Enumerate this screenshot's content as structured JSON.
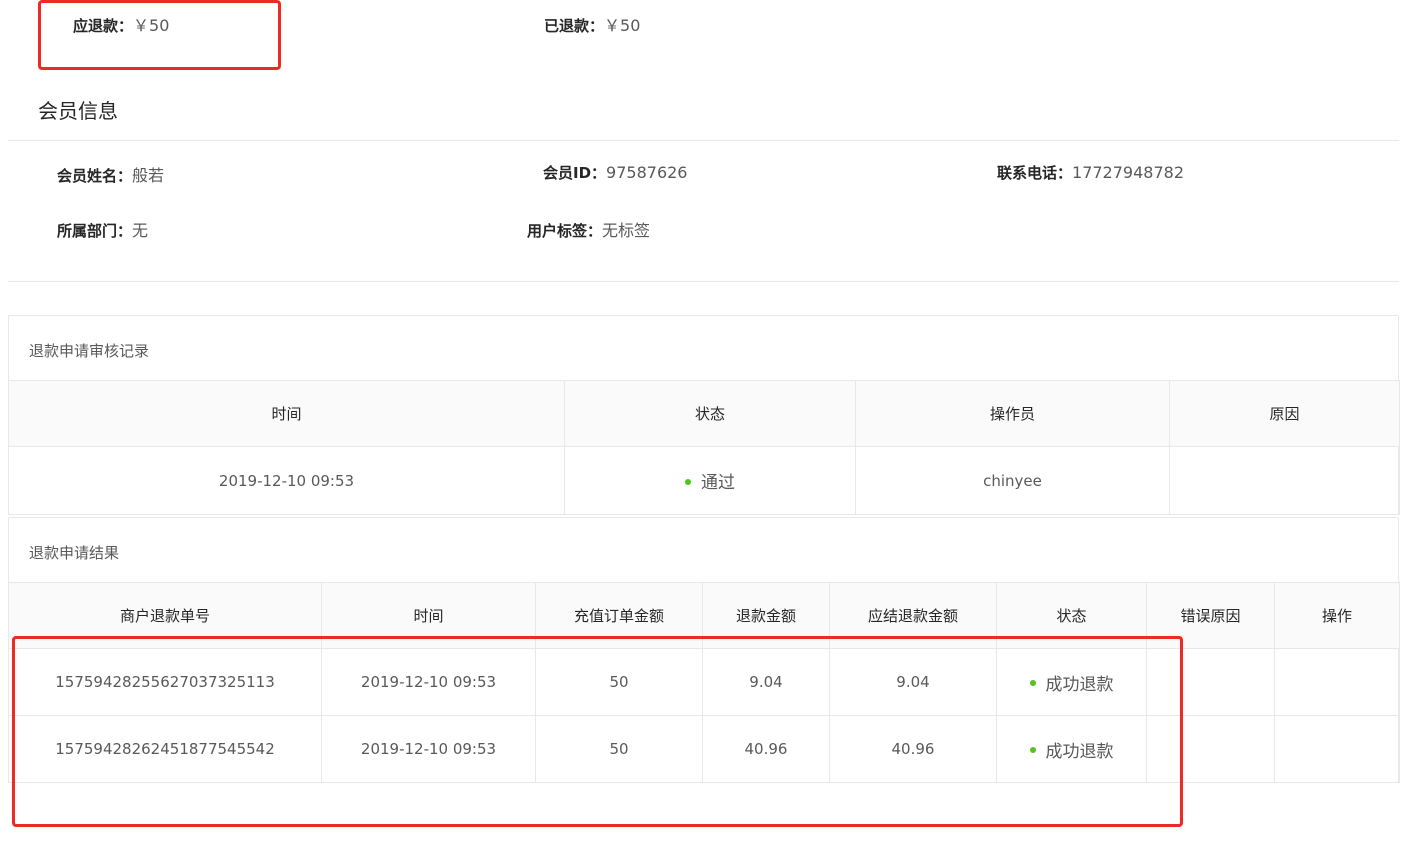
{
  "refund": {
    "due_label": "应退款：",
    "due_value": "￥50",
    "refunded_label": "已退款：",
    "refunded_value": "￥50"
  },
  "member": {
    "section_title": "会员信息",
    "name_label": "会员姓名：",
    "name_value": "般若",
    "id_label": "会员ID：",
    "id_value": "97587626",
    "phone_label": "联系电话：",
    "phone_value": "17727948782",
    "dept_label": "所属部门：",
    "dept_value": "无",
    "tag_label": "用户标签：",
    "tag_value": "无标签"
  },
  "review": {
    "title": "退款申请审核记录",
    "headers": [
      "时间",
      "状态",
      "操作员",
      "原因"
    ],
    "rows": [
      {
        "time": "2019-12-10 09:53",
        "status": "通过",
        "operator": "chinyee",
        "reason": ""
      }
    ]
  },
  "result": {
    "title": "退款申请结果",
    "headers": [
      "商户退款单号",
      "时间",
      "充值订单金额",
      "退款金额",
      "应结退款金额",
      "状态",
      "错误原因",
      "操作"
    ],
    "rows": [
      {
        "no": "15759428255627037325113",
        "time": "2019-12-10 09:53",
        "order_amount": "50",
        "refund_amount": "9.04",
        "settle_amount": "9.04",
        "status": "成功退款",
        "error": "",
        "action": ""
      },
      {
        "no": "15759428262451877545542",
        "time": "2019-12-10 09:53",
        "order_amount": "50",
        "refund_amount": "40.96",
        "settle_amount": "40.96",
        "status": "成功退款",
        "error": "",
        "action": ""
      }
    ]
  },
  "colors": {
    "success_dot": "#52c41a",
    "highlight_border": "#ee2a24"
  }
}
